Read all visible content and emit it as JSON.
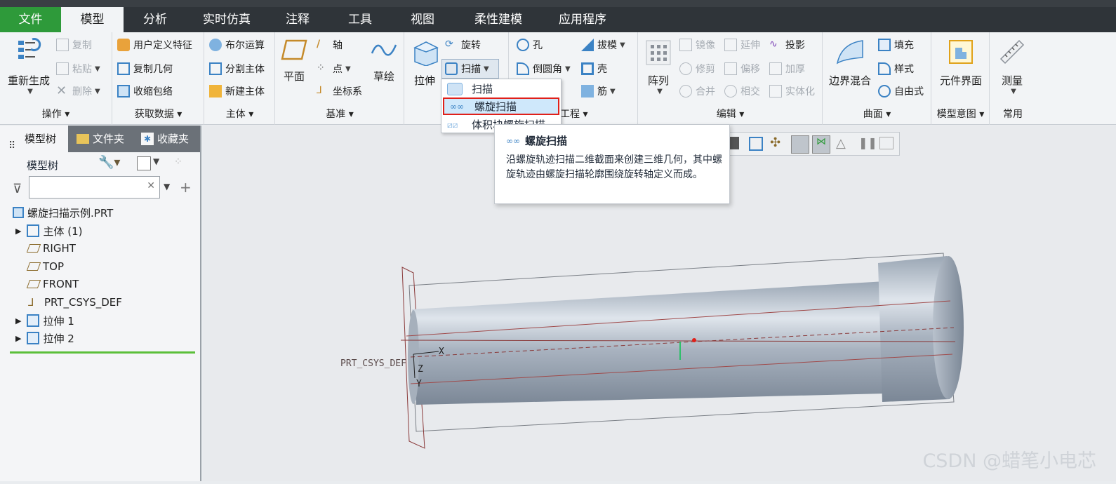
{
  "tabs": [
    "文件",
    "模型",
    "分析",
    "实时仿真",
    "注释",
    "工具",
    "视图",
    "柔性建模",
    "应用程序"
  ],
  "active_tab": "模型",
  "colors": {
    "file_tab": "#2e9a3a",
    "active_tab_bg": "#f2f4f6",
    "tabbar_bg": "#2f3439",
    "highlight_red": "#e0201a",
    "hover_blue": "#cfe8fb",
    "tree_green_line": "#5bbf3a"
  },
  "ribbon": {
    "operations": {
      "regenerate": "重新生成",
      "copy": "复制",
      "paste": "粘贴",
      "delete": "删除",
      "label": "操作"
    },
    "get_data": {
      "udf": "用户定义特征",
      "copy_geom": "复制几何",
      "shrinkwrap": "收缩包络",
      "label": "获取数据"
    },
    "body": {
      "boolean": "布尔运算",
      "split_body": "分割主体",
      "new_body": "新建主体",
      "label": "主体"
    },
    "datum": {
      "plane": "平面",
      "axis": "轴",
      "point": "点",
      "csys": "坐标系",
      "sketch": "草绘",
      "label": "基准"
    },
    "shapes": {
      "extrude": "拉伸",
      "revolve": "旋转",
      "sweep": "扫描"
    },
    "engineering": {
      "hole": "孔",
      "draft": "拔模",
      "round": "倒圆角",
      "shell": "壳",
      "rib": "筋",
      "label": "工程"
    },
    "edit": {
      "pattern": "阵列",
      "mirror": "镜像",
      "extend": "延伸",
      "project": "投影",
      "trim": "修剪",
      "offset": "偏移",
      "thicken": "加厚",
      "merge": "合并",
      "intersect": "相交",
      "solidify": "实体化",
      "label": "编辑"
    },
    "surfaces": {
      "boundary_blend": "边界混合",
      "fill": "填充",
      "style": "样式",
      "freestyle": "自由式",
      "label": "曲面"
    },
    "model_intent": {
      "component_interface": "元件界面",
      "label": "模型意图"
    },
    "common": {
      "measure": "测量",
      "label": "常用"
    }
  },
  "dropdown": {
    "items": [
      "扫描",
      "螺旋扫描",
      "体积块螺旋扫描"
    ],
    "selected": "螺旋扫描"
  },
  "tooltip": {
    "title": "螺旋扫描",
    "body": "沿螺旋轨迹扫描二维截面来创建三维几何，其中螺旋轨迹由螺旋扫描轮廓围绕旋转轴定义而成。"
  },
  "left_panel": {
    "tabs": [
      "模型树",
      "文件夹",
      "收藏夹"
    ],
    "header": "模型树",
    "search_placeholder": "",
    "tree": [
      "螺旋扫描示例.PRT",
      "主体 (1)",
      "RIGHT",
      "TOP",
      "FRONT",
      "PRT_CSYS_DEF",
      "拉伸 1",
      "拉伸 2"
    ]
  },
  "viewport": {
    "csys_label": "PRT_CSYS_DEF",
    "axis_x": "X",
    "axis_y": "Y",
    "axis_z": "Z"
  },
  "watermark": "CSDN @蜡笔小电芯"
}
